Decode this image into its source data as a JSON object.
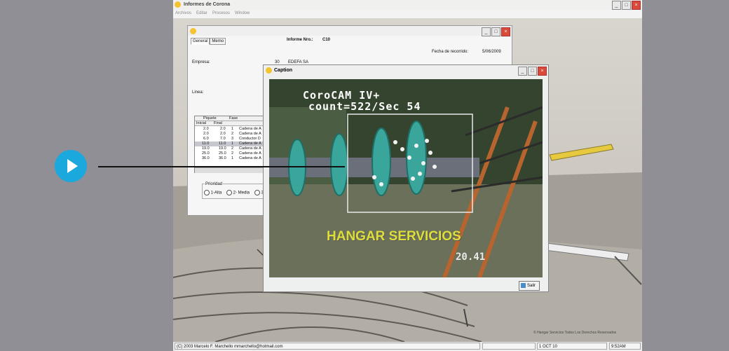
{
  "app": {
    "title": "Informes de Corona",
    "menu": [
      "Archivos",
      "Editar",
      "Procesos",
      "Window"
    ]
  },
  "informe_window": {
    "tabs": [
      "General",
      "Memo"
    ],
    "informe_label": "Informe Nro.:",
    "informe_value": "C10",
    "fecha_label": "Fecha de recorrido:",
    "fecha_value": "5/06/2009",
    "empresa_label": "Empresa:",
    "empresa_code": "30",
    "empresa_name": "EDEFA SA",
    "linea_label": "Linea:",
    "grid": {
      "header_piquete": "Piquete",
      "header_fase": "Fase",
      "col_inicial": "Inicial",
      "col_final": "Final",
      "rows": [
        {
          "inicial": "2.0",
          "final": "2.0",
          "fase": "1",
          "desc": "Cadena de A"
        },
        {
          "inicial": "2.0",
          "final": "2.0",
          "fase": "2",
          "desc": "Cadena de A"
        },
        {
          "inicial": "6.0",
          "final": "7.0",
          "fase": "3",
          "desc": "Conductor D"
        },
        {
          "inicial": "11.0",
          "final": "11.0",
          "fase": "1",
          "desc": "Cadena de A"
        },
        {
          "inicial": "19.0",
          "final": "19.0",
          "fase": "2",
          "desc": "Cadena de A"
        },
        {
          "inicial": "25.0",
          "final": "25.0",
          "fase": "2",
          "desc": "Cadena de A"
        },
        {
          "inicial": "36.0",
          "final": "36.0",
          "fase": "1",
          "desc": "Cadena de A"
        }
      ]
    },
    "prioridad_label": "Prioridad",
    "prioridad_options": [
      "1-Alta",
      "2- Media",
      "3"
    ]
  },
  "caption_window": {
    "title": "Caption",
    "osd_line1": "CoroCAM IV+",
    "osd_line2": "count=522/Sec 54",
    "brand_overlay": "HANGAR SERVICIOS",
    "counter_overlay": "20.41",
    "salir_label": "Salir"
  },
  "watermark": "© Hangar Servicios Todos Los Derechos Reservados",
  "statusbar": {
    "credit": "(C) 2003 Marcelo F. Marchello mmarchello@hotmail.com",
    "date": "1 OCT 10",
    "time": "9:52AM"
  },
  "colors": {
    "play_button": "#1aa8dd",
    "brand_yellow": "#dede3a"
  }
}
